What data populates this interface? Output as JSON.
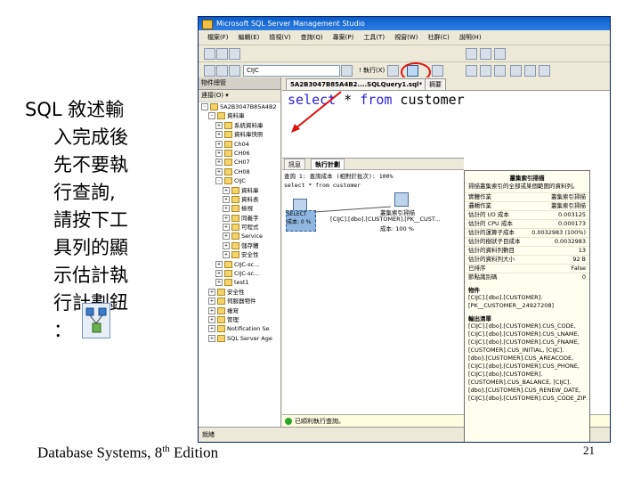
{
  "slide": {
    "text_lines": [
      "SQL 敘述輸",
      "入完成後",
      "先不要執",
      "行查詢,",
      "請按下工",
      "具列的顯",
      "示估計執",
      "行計劃鈕",
      "："
    ],
    "footer_main": "Database Systems, 8",
    "footer_sup": "th",
    "footer_tail": " Edition",
    "page_number": "21",
    "icon": "estimated-execution-plan-icon"
  },
  "ssms": {
    "title": "Microsoft SQL Server Management Studio",
    "menu": [
      "檔案(F)",
      "編輯(E)",
      "檢視(V)",
      "查詢(Q)",
      "專案(P)",
      "工具(T)",
      "視窗(W)",
      "社群(C)",
      "說明(H)"
    ],
    "database_selector": "CIJC",
    "execute_label": "! 執行(X)",
    "object_explorer": {
      "title": "物件總管",
      "connect_label": "連接(O) ▾",
      "items": [
        {
          "text": "5A2B3047B85A4B2",
          "indent": 0,
          "exp": "-"
        },
        {
          "text": "資料庫",
          "indent": 1,
          "exp": "-"
        },
        {
          "text": "系統資料庫",
          "indent": 2,
          "exp": "+"
        },
        {
          "text": "資料庫快照",
          "indent": 2,
          "exp": "+"
        },
        {
          "text": "Ch04",
          "indent": 2,
          "exp": "+"
        },
        {
          "text": "CH06",
          "indent": 2,
          "exp": "+"
        },
        {
          "text": "CH07",
          "indent": 2,
          "exp": "+"
        },
        {
          "text": "CH08",
          "indent": 2,
          "exp": "+"
        },
        {
          "text": "CIJC",
          "indent": 2,
          "exp": "-"
        },
        {
          "text": "資料庫",
          "indent": 3,
          "exp": "+"
        },
        {
          "text": "資料表",
          "indent": 3,
          "exp": "+"
        },
        {
          "text": "檢視",
          "indent": 3,
          "exp": "+"
        },
        {
          "text": "同義字",
          "indent": 3,
          "exp": "+"
        },
        {
          "text": "可程式",
          "indent": 3,
          "exp": "+"
        },
        {
          "text": "Service",
          "indent": 3,
          "exp": "+"
        },
        {
          "text": "儲存體",
          "indent": 3,
          "exp": "+"
        },
        {
          "text": "安全性",
          "indent": 3,
          "exp": "+"
        },
        {
          "text": "CIJC-sc...",
          "indent": 2,
          "exp": "+"
        },
        {
          "text": "CIJC-sc...",
          "indent": 2,
          "exp": "+"
        },
        {
          "text": "test1",
          "indent": 2,
          "exp": "+"
        },
        {
          "text": "安全性",
          "indent": 1,
          "exp": "+"
        },
        {
          "text": "伺服器物件",
          "indent": 1,
          "exp": "+"
        },
        {
          "text": "複寫",
          "indent": 1,
          "exp": "+"
        },
        {
          "text": "管理",
          "indent": 1,
          "exp": "+"
        },
        {
          "text": "Notification Se",
          "indent": 1,
          "exp": "+"
        },
        {
          "text": "SQL Server Age",
          "indent": 1,
          "exp": "+"
        }
      ]
    },
    "doc_tabs": [
      "5A2B3047B85A4B2....SQLQuery1.sql*",
      "摘要"
    ],
    "sql": {
      "kw1": "select",
      "star": " * ",
      "kw2": "from",
      "table": " customer"
    },
    "results_tabs": [
      "訊息",
      "執行計劃"
    ],
    "query_line1": "查詢 1: 查詢成本 (相對於批次): 100%",
    "query_line2": "select * from customer",
    "plan_select_label": "SELECT",
    "plan_select_cost": "成本: 0 %",
    "plan_scan_label": "叢集索引掃描",
    "plan_scan_detail": "[CIJC].[dbo].[CUSTOMER].[PK__CUST...",
    "plan_scan_cost": "成本: 100 %",
    "popup": {
      "title": "叢集索引掃描",
      "description": "掃描叢集索引的全部或某個範圍的資料列。",
      "rows": [
        {
          "k": "實體作業",
          "v": "叢集索引掃描"
        },
        {
          "k": "邏輯作業",
          "v": "叢集索引掃描"
        },
        {
          "k": "估計的 I/O 成本",
          "v": "0.003125"
        },
        {
          "k": "估計的 CPU 成本",
          "v": "0.000173"
        },
        {
          "k": "估計的運算子成本",
          "v": "0.0032983 (100%)"
        },
        {
          "k": "估計的樹狀子目成本",
          "v": "0.0032983"
        },
        {
          "k": "估計的資料列數目",
          "v": "13"
        },
        {
          "k": "估計的資料列大小",
          "v": "92 B"
        },
        {
          "k": "已排序",
          "v": "False"
        },
        {
          "k": "節點識別碼",
          "v": "0"
        }
      ],
      "object_title": "物件",
      "object_lines": [
        "[CIJC].[dbo].[CUSTOMER].",
        "[PK__CUSTOMER__24927208]"
      ],
      "output_title": "輸出清單",
      "output_lines": [
        "[CIJC].[dbo].[CUSTOMER].CUS_CODE,",
        "[CIJC].[dbo].[CUSTOMER].CUS_LNAME,",
        "[CIJC].[dbo].[CUSTOMER].CUS_FNAME,",
        "[CUSTOMER].CUS_INITIAL, [CIJC].",
        "[dbo].[CUSTOMER].CUS_AREACODE,",
        "[CIJC].[dbo].[CUSTOMER].CUS_PHONE,",
        "[CIJC].[dbo].[CUSTOMER].",
        "[CUSTOMER].CUS_BALANCE, [CIJC].",
        "[dbo].[CUSTOMER].CUS_RENEW_DATE,",
        "[CIJC].[dbo].[CUSTOMER].CUS_CODE_ZIP"
      ]
    },
    "query_status": "已順利執行查詢。",
    "status_bar": "就緒"
  }
}
